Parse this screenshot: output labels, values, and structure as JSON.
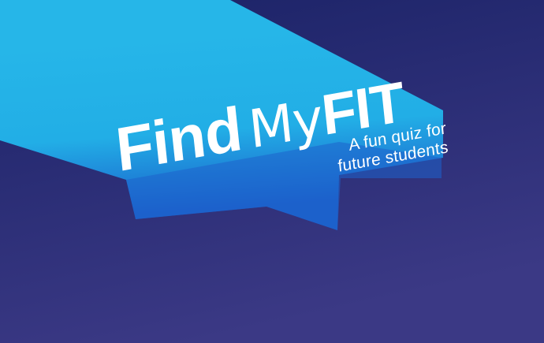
{
  "banner": {
    "title_find": "Find",
    "title_my": "My",
    "title_fit": "FIT",
    "subtitle_line1": "A fun quiz for",
    "subtitle_line2": "future students"
  },
  "colors": {
    "background_top": "#1c2467",
    "background_bottom": "#3a3a86",
    "beam_light": "#24b5e6",
    "beam_dark": "#1f66c8",
    "text": "#ffffff"
  }
}
